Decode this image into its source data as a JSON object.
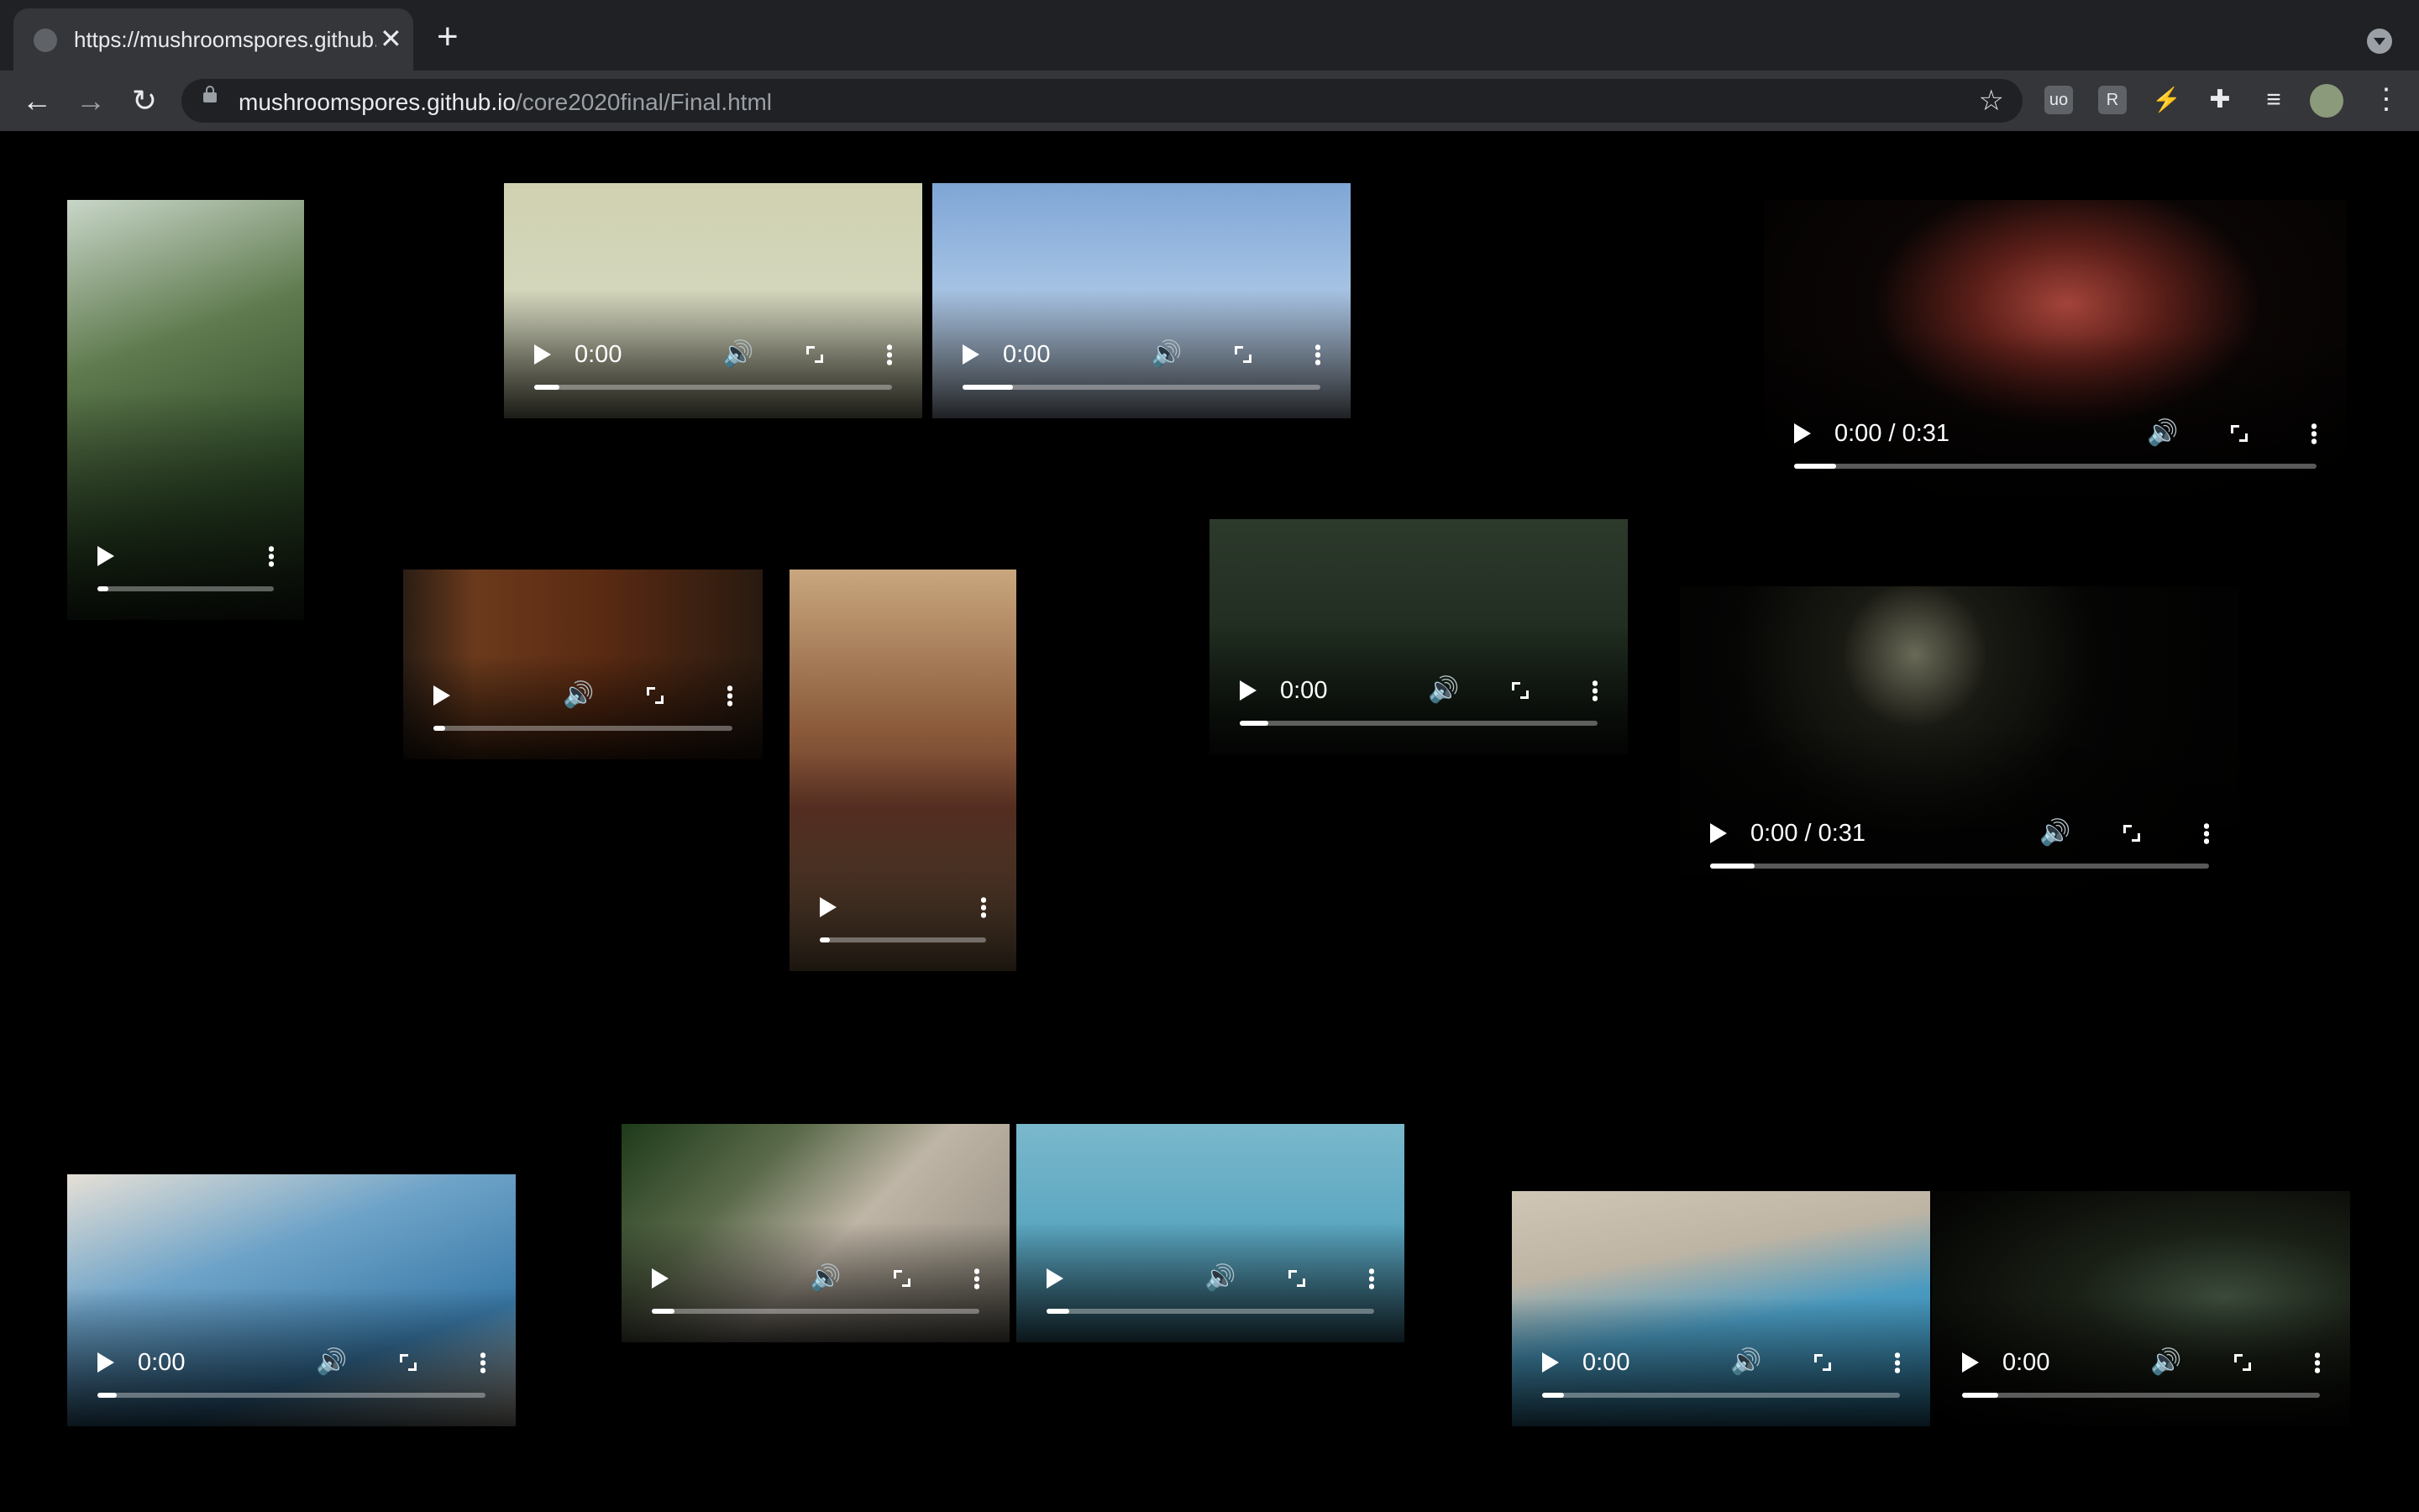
{
  "browser": {
    "tab_title": "https://mushroomspores.github.io/core2020final/Final.html",
    "new_tab_label": "+",
    "close_label": "✕",
    "url_host": "mushroomspores.github.io",
    "url_path": "/core2020final/Final.html",
    "star_label": "☆",
    "extensions": [
      "uo",
      "R",
      "⚡",
      "✚",
      "≡"
    ],
    "menu_label": "⋮"
  },
  "videos": [
    {
      "id": "v1",
      "time": "",
      "progress": 0.06,
      "scene": "palm-tree"
    },
    {
      "id": "v2",
      "time": "0:00",
      "progress": 0.07,
      "scene": "wall-fan"
    },
    {
      "id": "v3",
      "time": "0:00",
      "progress": 0.14,
      "scene": "clouds-sky"
    },
    {
      "id": "v4",
      "time": "0:00 / 0:31",
      "progress": 0.08,
      "scene": "night-balcony-red"
    },
    {
      "id": "v5",
      "time": "",
      "progress": 0.04,
      "scene": "window-grille"
    },
    {
      "id": "v6",
      "time": "",
      "progress": 0.06,
      "scene": "hanging-shirt"
    },
    {
      "id": "v7",
      "time": "0:00",
      "progress": 0.08,
      "scene": "blurred-trees"
    },
    {
      "id": "v8",
      "time": "0:00 / 0:31",
      "progress": 0.09,
      "scene": "night-windows"
    },
    {
      "id": "v9",
      "time": "0:00",
      "progress": 0.05,
      "scene": "pool-pillars"
    },
    {
      "id": "v10",
      "time": "",
      "progress": 0.07,
      "scene": "garden-path"
    },
    {
      "id": "v11",
      "time": "",
      "progress": 0.07,
      "scene": "pool-tiles"
    },
    {
      "id": "v12",
      "time": "0:00",
      "progress": 0.06,
      "scene": "pool-cone"
    },
    {
      "id": "v13",
      "time": "0:00",
      "progress": 0.1,
      "scene": "night-pool"
    }
  ]
}
